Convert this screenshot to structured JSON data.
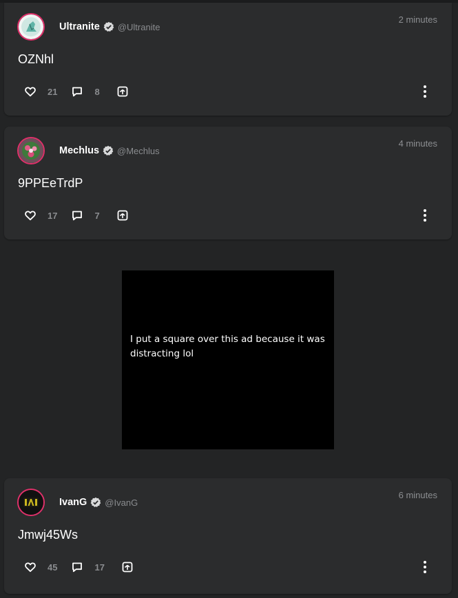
{
  "posts": [
    {
      "display_name": "Ultranite",
      "handle": "@Ultranite",
      "time": "2 minutes",
      "text": "OZNhl",
      "likes": "21",
      "comments": "8",
      "avatar_icon": "ultranite-avatar-icon"
    },
    {
      "display_name": "Mechlus",
      "handle": "@Mechlus",
      "time": "4 minutes",
      "text": "9PPEeTrdP",
      "likes": "17",
      "comments": "7",
      "avatar_icon": "mechlus-avatar-icon"
    },
    {
      "display_name": "IvanG",
      "handle": "@IvanG",
      "time": "6 minutes",
      "text": "Jmwj45Ws",
      "likes": "45",
      "comments": "17",
      "avatar_icon": "ivang-avatar-icon"
    }
  ],
  "ad": {
    "overlay_text": "I put a square over this ad because it was distracting lol"
  },
  "colors": {
    "background": "#232425",
    "card": "#2b2c2d",
    "avatar_ring": "#e0306a",
    "muted_text": "#8a8c8f",
    "primary_text": "#ffffff"
  },
  "icons": [
    "heart-icon",
    "comment-icon",
    "share-icon",
    "more-vertical-icon",
    "verified-badge-icon"
  ]
}
